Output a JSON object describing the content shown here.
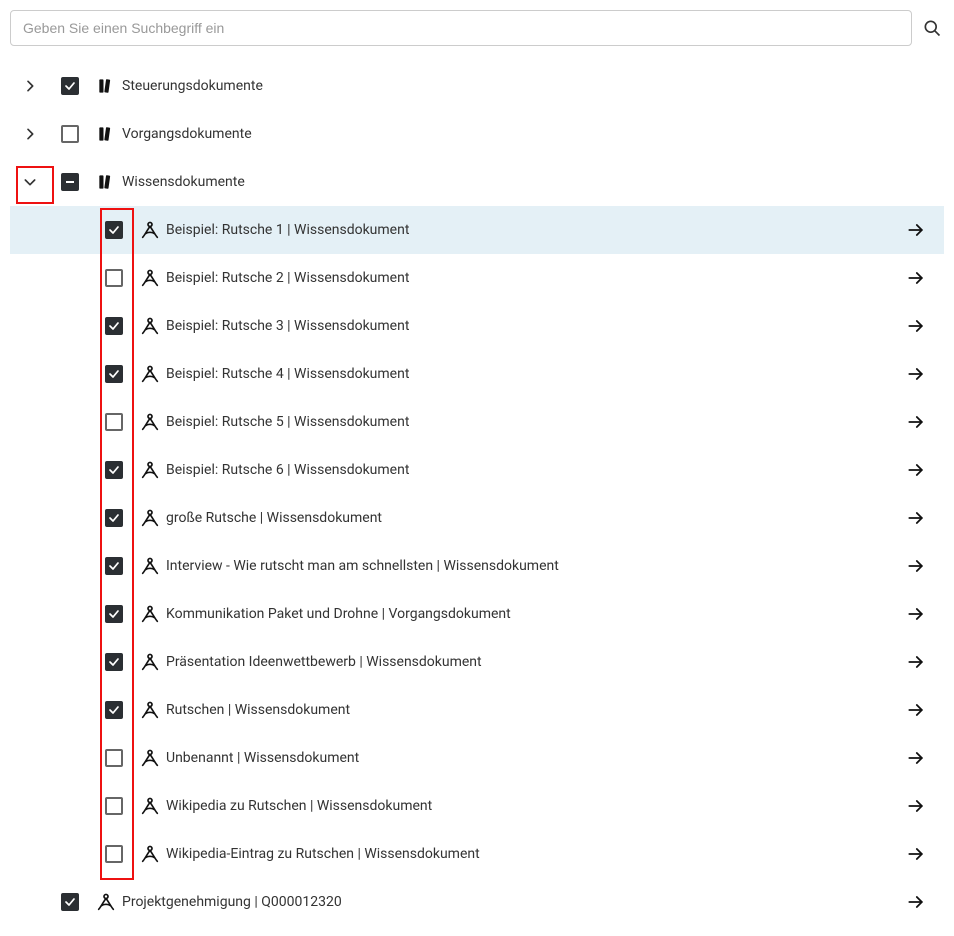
{
  "search": {
    "placeholder": "Geben Sie einen Suchbegriff ein"
  },
  "tree": {
    "folders": [
      {
        "id": "steuerung",
        "label": "Steuerungsdokumente",
        "expanded": false,
        "check": "checked",
        "hasChildren": true
      },
      {
        "id": "vorgang",
        "label": "Vorgangsdokumente",
        "expanded": false,
        "check": "unchecked",
        "hasChildren": true
      },
      {
        "id": "wissen",
        "label": "Wissensdokumente",
        "expanded": true,
        "check": "indeterminate",
        "hasChildren": true
      }
    ],
    "wissen_children": [
      {
        "label": "Beispiel: Rutsche 1 | Wissensdokument",
        "checked": true,
        "highlight": true
      },
      {
        "label": "Beispiel: Rutsche 2 | Wissensdokument",
        "checked": false,
        "highlight": false
      },
      {
        "label": "Beispiel: Rutsche 3 | Wissensdokument",
        "checked": true,
        "highlight": false
      },
      {
        "label": "Beispiel: Rutsche 4 | Wissensdokument",
        "checked": true,
        "highlight": false
      },
      {
        "label": "Beispiel: Rutsche 5 | Wissensdokument",
        "checked": false,
        "highlight": false
      },
      {
        "label": "Beispiel: Rutsche 6 | Wissensdokument",
        "checked": true,
        "highlight": false
      },
      {
        "label": "große Rutsche | Wissensdokument",
        "checked": true,
        "highlight": false
      },
      {
        "label": "Interview - Wie rutscht man am schnellsten | Wissensdokument",
        "checked": true,
        "highlight": false
      },
      {
        "label": "Kommunikation Paket und Drohne | Vorgangsdokument",
        "checked": true,
        "highlight": false
      },
      {
        "label": "Präsentation Ideenwettbewerb | Wissensdokument",
        "checked": true,
        "highlight": false
      },
      {
        "label": "Rutschen | Wissensdokument",
        "checked": true,
        "highlight": false
      },
      {
        "label": "Unbenannt | Wissensdokument",
        "checked": false,
        "highlight": false
      },
      {
        "label": "Wikipedia zu Rutschen | Wissensdokument",
        "checked": false,
        "highlight": false
      },
      {
        "label": "Wikipedia-Eintrag zu Rutschen | Wissensdokument",
        "checked": false,
        "highlight": false
      }
    ],
    "root_doc": {
      "label": "Projektgenehmigung | Q000012320",
      "checked": true
    }
  }
}
